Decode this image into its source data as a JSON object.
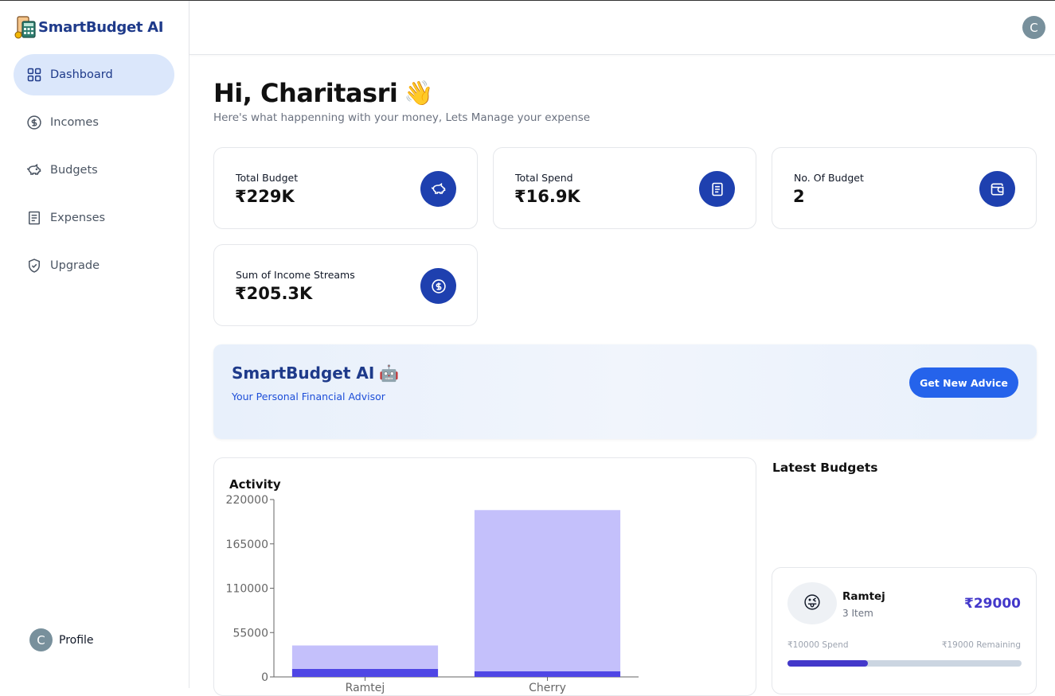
{
  "app": {
    "name": "SmartBudget AI"
  },
  "sidebar": {
    "items": [
      {
        "label": "Dashboard",
        "icon": "grid-icon",
        "active": true
      },
      {
        "label": "Incomes",
        "icon": "dollar-circle-icon",
        "active": false
      },
      {
        "label": "Budgets",
        "icon": "piggy-bank-icon",
        "active": false
      },
      {
        "label": "Expenses",
        "icon": "receipt-icon",
        "active": false
      },
      {
        "label": "Upgrade",
        "icon": "shield-check-icon",
        "active": false
      }
    ],
    "profile": {
      "initial": "C",
      "label": "Profile"
    }
  },
  "header": {
    "avatar_initial": "C"
  },
  "greeting": {
    "title": "Hi, Charitasri",
    "emoji": "👋",
    "subtitle": "Here's what happenning with your money, Lets Manage your expense"
  },
  "stats": [
    {
      "label": "Total Budget",
      "value": "₹229K",
      "icon": "piggy-bank-icon"
    },
    {
      "label": "Total Spend",
      "value": "₹16.9K",
      "icon": "receipt-icon"
    },
    {
      "label": "No. Of Budget",
      "value": "2",
      "icon": "wallet-icon"
    },
    {
      "label": "Sum of Income Streams",
      "value": "₹205.3K",
      "icon": "dollar-circle-icon"
    }
  ],
  "advisor": {
    "title": "SmartBudget AI",
    "emoji": "🤖",
    "subtitle": "Your Personal Financial Advisor",
    "button": "Get New Advice"
  },
  "activity": {
    "title": "Activity"
  },
  "chart_data": {
    "type": "bar",
    "stacked": true,
    "categories": [
      "Ramtej",
      "Cherry"
    ],
    "series": [
      {
        "values": [
          10000,
          6900
        ],
        "color": "#4f46e5"
      },
      {
        "values": [
          29000,
          200000
        ],
        "color": "#c4c0fb"
      }
    ],
    "yticks": [
      0,
      55000,
      110000,
      165000,
      220000
    ],
    "ylim": [
      0,
      220000
    ]
  },
  "latest": {
    "title": "Latest Budgets",
    "budgets": [
      {
        "emoji": "😜",
        "name": "Ramtej",
        "items": "3 Item",
        "amount": "₹29000",
        "spend": "₹10000 Spend",
        "remaining": "₹19000 Remaining",
        "progress": 0.345
      }
    ]
  },
  "colors": {
    "primary": "#1e40af",
    "accent": "#2563eb",
    "active_nav": "#dbe7fb",
    "bar_dark": "#4f46e5",
    "bar_light": "#c4c0fb"
  }
}
